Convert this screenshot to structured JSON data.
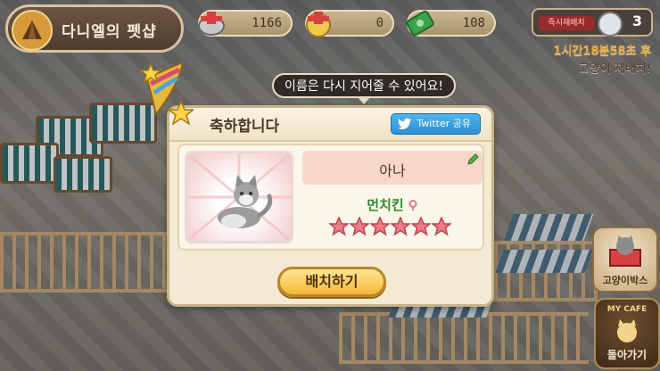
{
  "top_bar": {
    "title": "다니엘의 펫샵",
    "resources": [
      {
        "name": "food",
        "value": "1166",
        "icon": "fish-can-icon"
      },
      {
        "name": "coins",
        "value": "0",
        "icon": "coin-bag-icon"
      },
      {
        "name": "cash",
        "value": "108",
        "icon": "cash-icon"
      }
    ]
  },
  "reset": {
    "label": "즉시재배치",
    "count": "3",
    "timer_line1": "1시간18분58초 후",
    "timer_line2": "고양이 재배치!"
  },
  "side_buttons": {
    "catbox_label": "고양이박스",
    "cafe_top": "MY CAFE",
    "back_label": "돌아가기"
  },
  "tooltip": "이름은 다시 지어줄 수 있어요!",
  "dialog": {
    "title": "축하합니다",
    "twitter_label": "Twitter 공유",
    "cat": {
      "name": "아나",
      "breed": "먼치킨",
      "gender": "female",
      "stars": 6
    },
    "action_label": "배치하기"
  },
  "colors": {
    "dialog_bg": "#f4ead3",
    "name_bg": "#f6d7c8",
    "breed_green": "#2f8a2c",
    "star_fill": "#f07b84",
    "button_gold": "#f3b934",
    "twitter_blue": "#2b8fd4"
  }
}
